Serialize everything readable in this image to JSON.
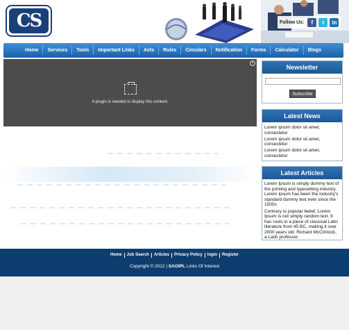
{
  "logo": {
    "text": "CS"
  },
  "social": {
    "label": "Follow Us:",
    "icons": [
      {
        "name": "facebook-icon",
        "glyph": "f",
        "color": "#3b5998"
      },
      {
        "name": "twitter-icon",
        "glyph": "t",
        "color": "#33b3e3"
      },
      {
        "name": "linkedin-icon",
        "glyph": "in",
        "color": "#1e74b5"
      }
    ]
  },
  "nav": {
    "items": [
      "Home",
      "Services",
      "Tools",
      "Important Links",
      "Acts",
      "Rules",
      "Circulars",
      "Notification",
      "Forms",
      "Calculator",
      "Blogs"
    ]
  },
  "plugin": {
    "message": "A plugin is needed to display this content."
  },
  "newsletter": {
    "title": "Newsletter",
    "email_value": "",
    "subscribe_label": "Subscribe"
  },
  "latest_news": {
    "title": "Latest News",
    "items": [
      "Lorem ipsum dolor sit amet, consectetur",
      "Lorem ipsum dolor sit amet, consectetur",
      "Lorem ipsum dolor sit amet, consectetur"
    ]
  },
  "latest_articles": {
    "title": "Latest Articles",
    "paragraphs": [
      "Lorem Ipsum is simply dummy text of the printing and typesetting industry. Lorem Ipsum has been the industry's standard dummy text ever since the 1500s",
      "Contrary to popular belief, Lorem Ipsum is not simply random text. It has roots in a piece of classical Latin literature from 45 BC, making it over 2000 years old. Richard McClintock, a Latin professor"
    ]
  },
  "footer": {
    "links": [
      "Home",
      "Job Search",
      "Articles",
      "Privacy Policy",
      "login",
      "Register"
    ],
    "copyright_prefix": "Copyright © 2012 |",
    "copyright_brand": "SAGIPL",
    "copyright_suffix": "Links Of Interest"
  },
  "colors": {
    "brand": "#1a3f7a",
    "nav": "#1b5fa8",
    "footer": "#0d3d6e"
  }
}
